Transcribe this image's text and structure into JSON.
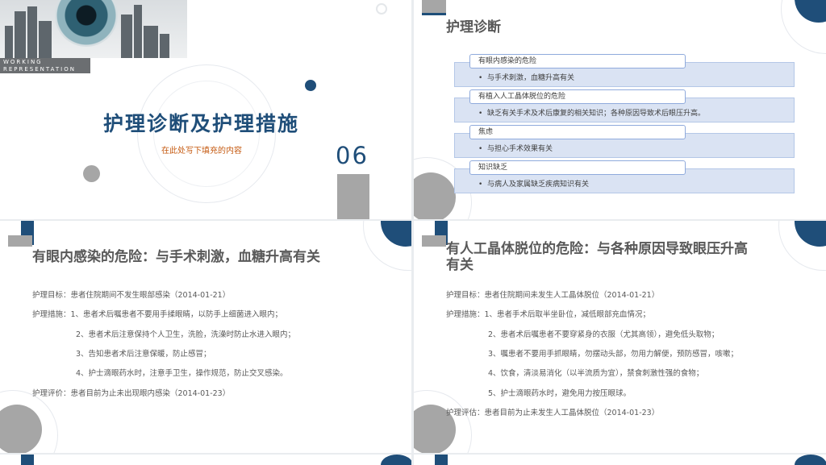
{
  "slide1": {
    "banner_tag_line1": "WORKING",
    "banner_tag_line2": "REPRESENTATION",
    "title": "护理诊断及护理措施",
    "subtitle": "在此处写下填充的内容",
    "number": "06"
  },
  "slide2": {
    "title": "护理诊断",
    "diagnoses": [
      {
        "head": "有眼内感染的危险",
        "item": "与手术刺激，血糖升高有关"
      },
      {
        "head": "有植入人工晶体脱位的危险",
        "item": "缺乏有关手术及术后康复的相关知识；各种原因导致术后眼压升高。"
      },
      {
        "head": "焦虑",
        "item": "与担心手术效果有关"
      },
      {
        "head": "知识缺乏",
        "item": "与病人及家属缺乏疾病知识有关"
      }
    ]
  },
  "slide3": {
    "title": "有眼内感染的危险：与手术刺激，血糖升高有关",
    "lines": [
      "护理目标：患者住院期间不发生眼部感染（2014-01-21）",
      "护理措施：1、患者术后嘱患者不要用手揉眼睛，以防手上细菌进入眼内；",
      "2、患者术后注意保持个人卫生，洗脸，洗澡时防止水进入眼内；",
      "3、告知患者术后注意保暖，防止感冒；",
      "4、护士滴眼药水时，注意手卫生，操作规范，防止交叉感染。",
      "护理评价：患者目前为止未出现眼内感染（2014-01-23）"
    ]
  },
  "slide4": {
    "title_line1": "有人工晶体脱位的危险：与各种原因导致眼压升高",
    "title_line2": "有关",
    "lines": [
      "护理目标：患者住院期间未发生人工晶体脱位（2014-01-21）",
      "护理措施：1、患者手术后取半坐卧位，减低眼部充血情况；",
      "2、患者术后嘱患者不要穿紧身的衣服（尤其高领），避免低头取物；",
      "3、嘱患者不要用手抓眼睛，勿摆动头部，勿用力解便，预防感冒，咳嗽；",
      "4、饮食，清淡易消化（以半流质为宜），禁食刺激性强的食物；",
      "5、护士滴眼药水时，避免用力按压眼球。",
      "护理评估：患者目前为止未发生人工晶体脱位（2014-01-23）"
    ]
  },
  "colors": {
    "navy": "#1f4e79",
    "grey": "#a6a6a6",
    "orange": "#c55a11",
    "box_fill": "#dae3f3"
  }
}
